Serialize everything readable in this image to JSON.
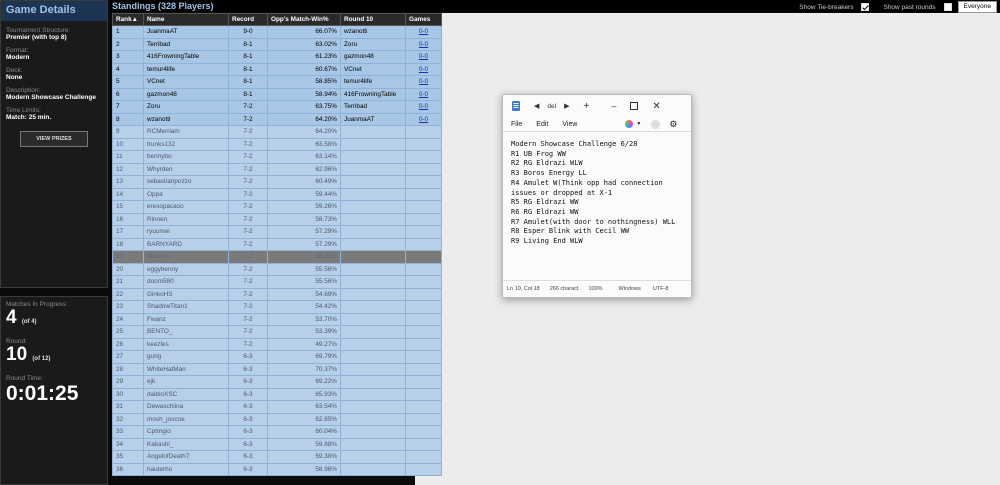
{
  "game_details": {
    "title": "Game Details",
    "tournament_structure_label": "Tournament Structure:",
    "tournament_structure": "Premier (with top 8)",
    "format_label": "Format:",
    "format": "Modern",
    "deck_label": "Deck:",
    "deck": "None",
    "description_label": "Description:",
    "description": "Modern Showcase Challenge",
    "time_limits_label": "Time Limits:",
    "time_limits": "Match: 25 min.",
    "view_prizes": "VIEW PRIZES"
  },
  "status": {
    "matches_label": "Matches In Progress:",
    "matches": "4",
    "matches_of": "(of 4)",
    "round_label": "Round:",
    "round": "10",
    "round_of": "(of 12)",
    "round_time_label": "Round Time:",
    "round_time": "0:01:25"
  },
  "standings": {
    "title": "Standings (328 Players)",
    "show_tiebreakers": "Show Tie-breakers",
    "show_tiebreakers_checked": true,
    "show_past_rounds": "Show past rounds",
    "show_past_rounds_checked": false,
    "filter": "Everyone",
    "columns": [
      "Rank▲",
      "Name",
      "Record",
      "Opp's Match-Win%",
      "Round 10",
      "Games"
    ],
    "rows": [
      {
        "rank": "1",
        "name": "JuanmaAT",
        "record": "9-0",
        "omw": "66.07%",
        "opp": "wzanotti",
        "games": "0-0"
      },
      {
        "rank": "2",
        "name": "Terribad",
        "record": "8-1",
        "omw": "63.02%",
        "opp": "Zoru",
        "games": "0-0"
      },
      {
        "rank": "3",
        "name": "416FrowningTable",
        "record": "8-1",
        "omw": "61.23%",
        "opp": "gazmon48",
        "games": "0-0"
      },
      {
        "rank": "4",
        "name": "temur4life",
        "record": "8-1",
        "omw": "60.67%",
        "opp": "VCnet",
        "games": "0-0"
      },
      {
        "rank": "5",
        "name": "VCnet",
        "record": "8-1",
        "omw": "58.85%",
        "opp": "temur4life",
        "games": "0-0"
      },
      {
        "rank": "6",
        "name": "gazmon48",
        "record": "8-1",
        "omw": "58.94%",
        "opp": "416FrowningTable",
        "games": "0-0"
      },
      {
        "rank": "7",
        "name": "Zoru",
        "record": "7-2",
        "omw": "63.75%",
        "opp": "Terribad",
        "games": "0-0"
      },
      {
        "rank": "8",
        "name": "wzanotti",
        "record": "7-2",
        "omw": "64.20%",
        "opp": "JuanmaAT",
        "games": "0-0"
      },
      {
        "rank": "9",
        "name": "RCMerriam",
        "record": "7-2",
        "omw": "64.20%",
        "opp": "",
        "games": ""
      },
      {
        "rank": "10",
        "name": "trunks132",
        "record": "7-2",
        "omw": "63.58%",
        "opp": "",
        "games": ""
      },
      {
        "rank": "11",
        "name": "bennybo",
        "record": "7-2",
        "omw": "63.14%",
        "opp": "",
        "games": ""
      },
      {
        "rank": "12",
        "name": "Whyrden",
        "record": "7-2",
        "omw": "62.96%",
        "opp": "",
        "games": ""
      },
      {
        "rank": "13",
        "name": "sebastianpozzo",
        "record": "7-2",
        "omw": "60.49%",
        "opp": "",
        "games": ""
      },
      {
        "rank": "14",
        "name": "Oppa",
        "record": "7-2",
        "omw": "59.44%",
        "opp": "",
        "games": ""
      },
      {
        "rank": "15",
        "name": "eresopacaso",
        "record": "7-2",
        "omw": "59.26%",
        "opp": "",
        "games": ""
      },
      {
        "rank": "16",
        "name": "Rinnen",
        "record": "7-2",
        "omw": "58.73%",
        "opp": "",
        "games": ""
      },
      {
        "rank": "17",
        "name": "ryuumei",
        "record": "7-2",
        "omw": "57.29%",
        "opp": "",
        "games": ""
      },
      {
        "rank": "18",
        "name": "BARNYARD",
        "record": "7-2",
        "omw": "57.29%",
        "opp": "",
        "games": ""
      },
      {
        "rank": "19",
        "name": "Mikelvw",
        "record": "7-2",
        "omw": "56.35%",
        "opp": "",
        "games": ""
      },
      {
        "rank": "20",
        "name": "eggybenny",
        "record": "7-2",
        "omw": "55.56%",
        "opp": "",
        "games": ""
      },
      {
        "rank": "21",
        "name": "doom580",
        "record": "7-2",
        "omw": "55.56%",
        "opp": "",
        "games": ""
      },
      {
        "rank": "22",
        "name": "GinkoHS",
        "record": "7-2",
        "omw": "54.69%",
        "opp": "",
        "games": ""
      },
      {
        "rank": "23",
        "name": "ShadowTitan1",
        "record": "7-2",
        "omw": "54.42%",
        "opp": "",
        "games": ""
      },
      {
        "rank": "24",
        "name": "Fwanz",
        "record": "7-2",
        "omw": "53.70%",
        "opp": "",
        "games": ""
      },
      {
        "rank": "25",
        "name": "BENTO_",
        "record": "7-2",
        "omw": "53.39%",
        "opp": "",
        "games": ""
      },
      {
        "rank": "26",
        "name": "keezles",
        "record": "7-2",
        "omw": "49.27%",
        "opp": "",
        "games": ""
      },
      {
        "rank": "27",
        "name": "gurig",
        "record": "6-3",
        "omw": "69.79%",
        "opp": "",
        "games": ""
      },
      {
        "rank": "28",
        "name": "WhiteHatMan",
        "record": "6-3",
        "omw": "70.37%",
        "opp": "",
        "games": ""
      },
      {
        "rank": "29",
        "name": "ejk",
        "record": "6-3",
        "omw": "69.22%",
        "opp": "",
        "games": ""
      },
      {
        "rank": "30",
        "name": "daibloXSC",
        "record": "6-3",
        "omw": "65.93%",
        "opp": "",
        "games": ""
      },
      {
        "rank": "31",
        "name": "Dewaschiina",
        "record": "6-3",
        "omw": "63.54%",
        "opp": "",
        "games": ""
      },
      {
        "rank": "32",
        "name": "mosh_joscoe",
        "record": "6-3",
        "omw": "62.65%",
        "opp": "",
        "games": ""
      },
      {
        "rank": "33",
        "name": "CptIngio",
        "record": "6-3",
        "omw": "60.04%",
        "opp": "",
        "games": ""
      },
      {
        "rank": "34",
        "name": "Kakashi_",
        "record": "6-3",
        "omw": "59.88%",
        "opp": "",
        "games": ""
      },
      {
        "rank": "35",
        "name": "AngelofDeath7",
        "record": "6-3",
        "omw": "59.38%",
        "opp": "",
        "games": ""
      },
      {
        "rank": "36",
        "name": "hauterho",
        "record": "6-3",
        "omw": "58.96%",
        "opp": "",
        "games": ""
      }
    ]
  },
  "notepad": {
    "tab_name": "del",
    "menu": [
      "File",
      "Edit",
      "View"
    ],
    "lines": [
      "Modern Showcase Challenge 6/28",
      "R1 UB Frog WW",
      "R2 RG Eldrazi WLW",
      "R3 Boros Energy LL",
      "R4 Amulet W(Think opp had connection",
      "issues or dropped at X-1",
      "R5 RG Eldrazi WW",
      "R6 RG Eldrazi WW",
      "R7 Amulet(with door to nothingness) WLL",
      "R8 Esper Blink with Cecil WW",
      "R9 Living End WLW"
    ],
    "status_pos": "Ln 10, Col 18",
    "status_chars": "266 charact",
    "status_zoom": "100%",
    "status_eol": "Windows",
    "status_enc": "UTF-8"
  }
}
